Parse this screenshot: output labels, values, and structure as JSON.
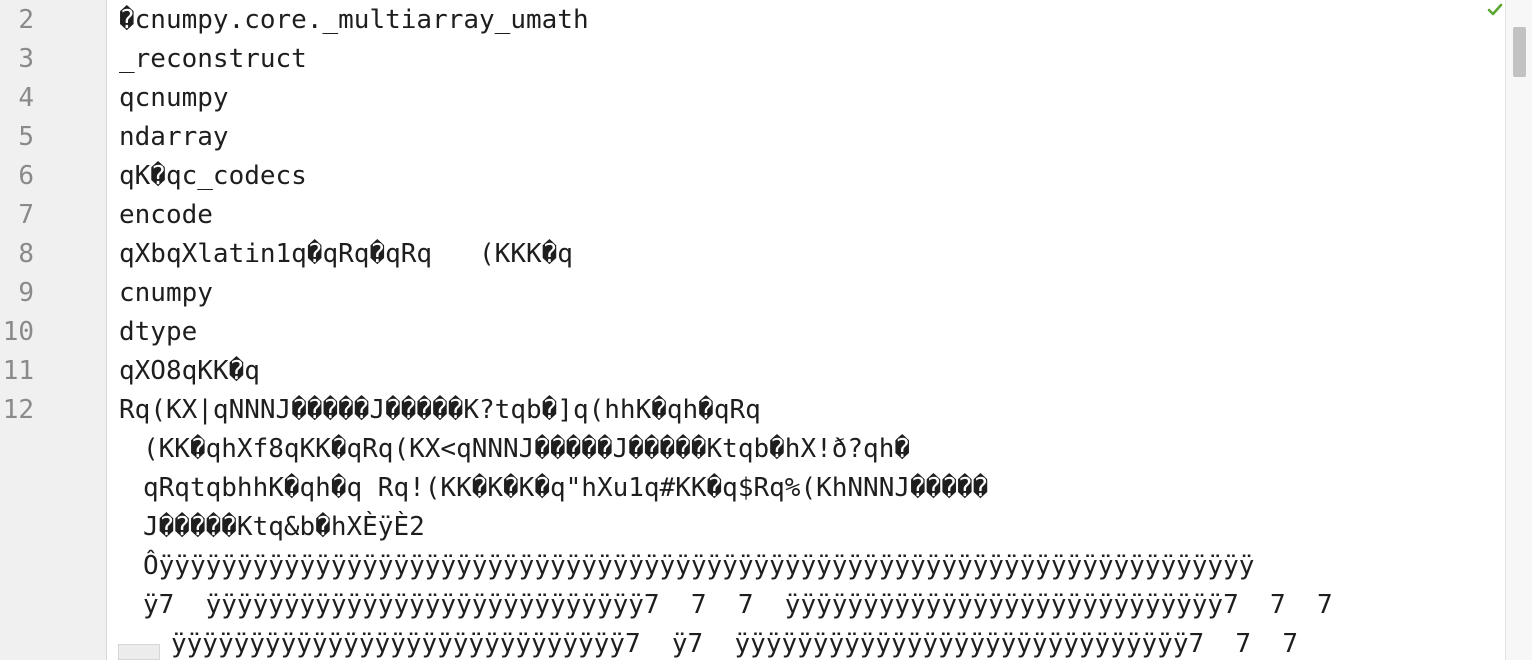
{
  "editor": {
    "lines": [
      {
        "number": "2",
        "text": "�\u0005cnumpy.core._multiarray_umath"
      },
      {
        "number": "3",
        "text": "_reconstruct"
      },
      {
        "number": "4",
        "text": "qcnumpy"
      },
      {
        "number": "5",
        "text": "ndarray"
      },
      {
        "number": "6",
        "text": "q\u0001K�q\u0002c_codecs"
      },
      {
        "number": "7",
        "text": "encode"
      },
      {
        "number": "8",
        "text": "q\u0003X\u0001bq\u0004X\u0006latin1q\u0005�q\u0006Rq\u0007�q\bRq   (K\u0001K\u0003K\u0003�q"
      },
      {
        "number": "9",
        "text": "cnumpy"
      },
      {
        "number": "10",
        "text": "dtype"
      },
      {
        "number": "11",
        "text": "q\u000bX\u0002O8q\u000bKK\u0001�q"
      },
      {
        "number": "12",
        "text": "Rq\r(K\u0003X\u0001|q\u000eNNNJ�����J�����K?tq\u000fb�]q\u0010(hh\u0001K�q\u0011h\u0005�q\u0012Rq\u0013"
      }
    ],
    "wrapped_lines": [
      "(K\u0001K\u0003�q\u0014h\u0011X\u0002f8q\u0015KK\u0003�q\u0016Rq\u0017(K\u0003X\u0001<q\u0018NNNJ�����J�����Ktq\u0019b�h\u0005X!ð?q\u001ah\u0006�",
      "q\u001bRq\u001ctq\u001dbhh\u0001K�q\u001eh\u0005�q Rq!(K\u0001K�K�K\u0003�q\"h\u0011X\u0002u1q#KK\u0003�q$Rq%(K\u0003h\u0001NNNJ�����",
      "J�����Ktq&b�h\u0005XЀ\u0005ÿÈ2",
      "Ôÿÿÿÿÿÿÿÿÿÿÿÿÿÿÿÿÿÿÿÿÿÿÿÿÿÿÿÿÿÿÿÿÿÿÿÿÿÿÿÿÿÿÿÿÿÿÿÿÿÿÿÿÿÿÿÿÿÿÿÿÿÿÿÿÿÿÿÿÿÿ",
      "ÿ7  ÿÿÿÿÿÿÿÿÿÿÿÿÿÿÿÿÿÿÿÿÿÿÿÿÿÿÿÿ7  7  7  ÿÿÿÿÿÿÿÿÿÿÿÿÿÿÿÿÿÿÿÿÿÿÿÿÿÿÿÿ7  7  7",
      "ÿÿÿÿÿÿÿÿÿÿÿÿÿÿÿÿÿÿÿÿÿÿÿÿÿÿÿÿÿ7  ÿ7  ÿÿÿÿÿÿÿÿÿÿÿÿÿÿÿÿÿÿÿÿÿÿÿÿÿÿÿÿÿ7  7  7"
    ]
  },
  "status": {
    "icon": "check-icon",
    "color": "#5aa832"
  },
  "colors": {
    "gutter_bg": "#f0f0f0",
    "line_number": "#8a8a8a",
    "text": "#1e1e1e",
    "scroll_thumb": "#c2c2c2"
  }
}
